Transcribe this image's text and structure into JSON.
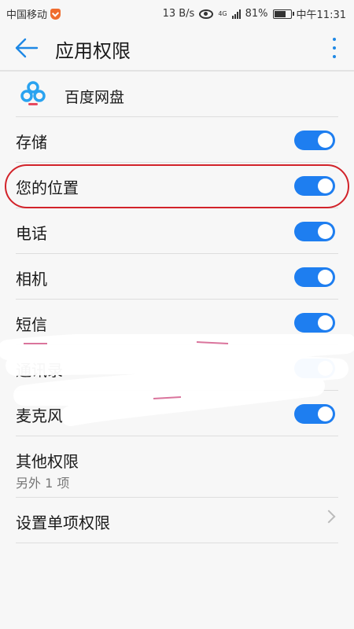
{
  "status_bar": {
    "carrier": "中国移动",
    "speed": "13 B/s",
    "network": "4G",
    "battery": "81%",
    "battery_level": 0.81,
    "time": "中午11:31"
  },
  "app_bar": {
    "title": "应用权限"
  },
  "app": {
    "name": "百度网盘"
  },
  "permissions": [
    {
      "label": "存储",
      "enabled": true
    },
    {
      "label": "您的位置",
      "enabled": true
    },
    {
      "label": "电话",
      "enabled": true
    },
    {
      "label": "相机",
      "enabled": true
    },
    {
      "label": "短信",
      "enabled": true
    },
    {
      "label": "通讯录",
      "enabled": true
    },
    {
      "label": "麦克风",
      "enabled": true
    }
  ],
  "other_permissions": {
    "label": "其他权限",
    "sublabel": "另外 1 项"
  },
  "single_item": {
    "label": "设置单项权限"
  },
  "colors": {
    "accent": "#1e7ef0",
    "highlight": "#d2232a"
  }
}
